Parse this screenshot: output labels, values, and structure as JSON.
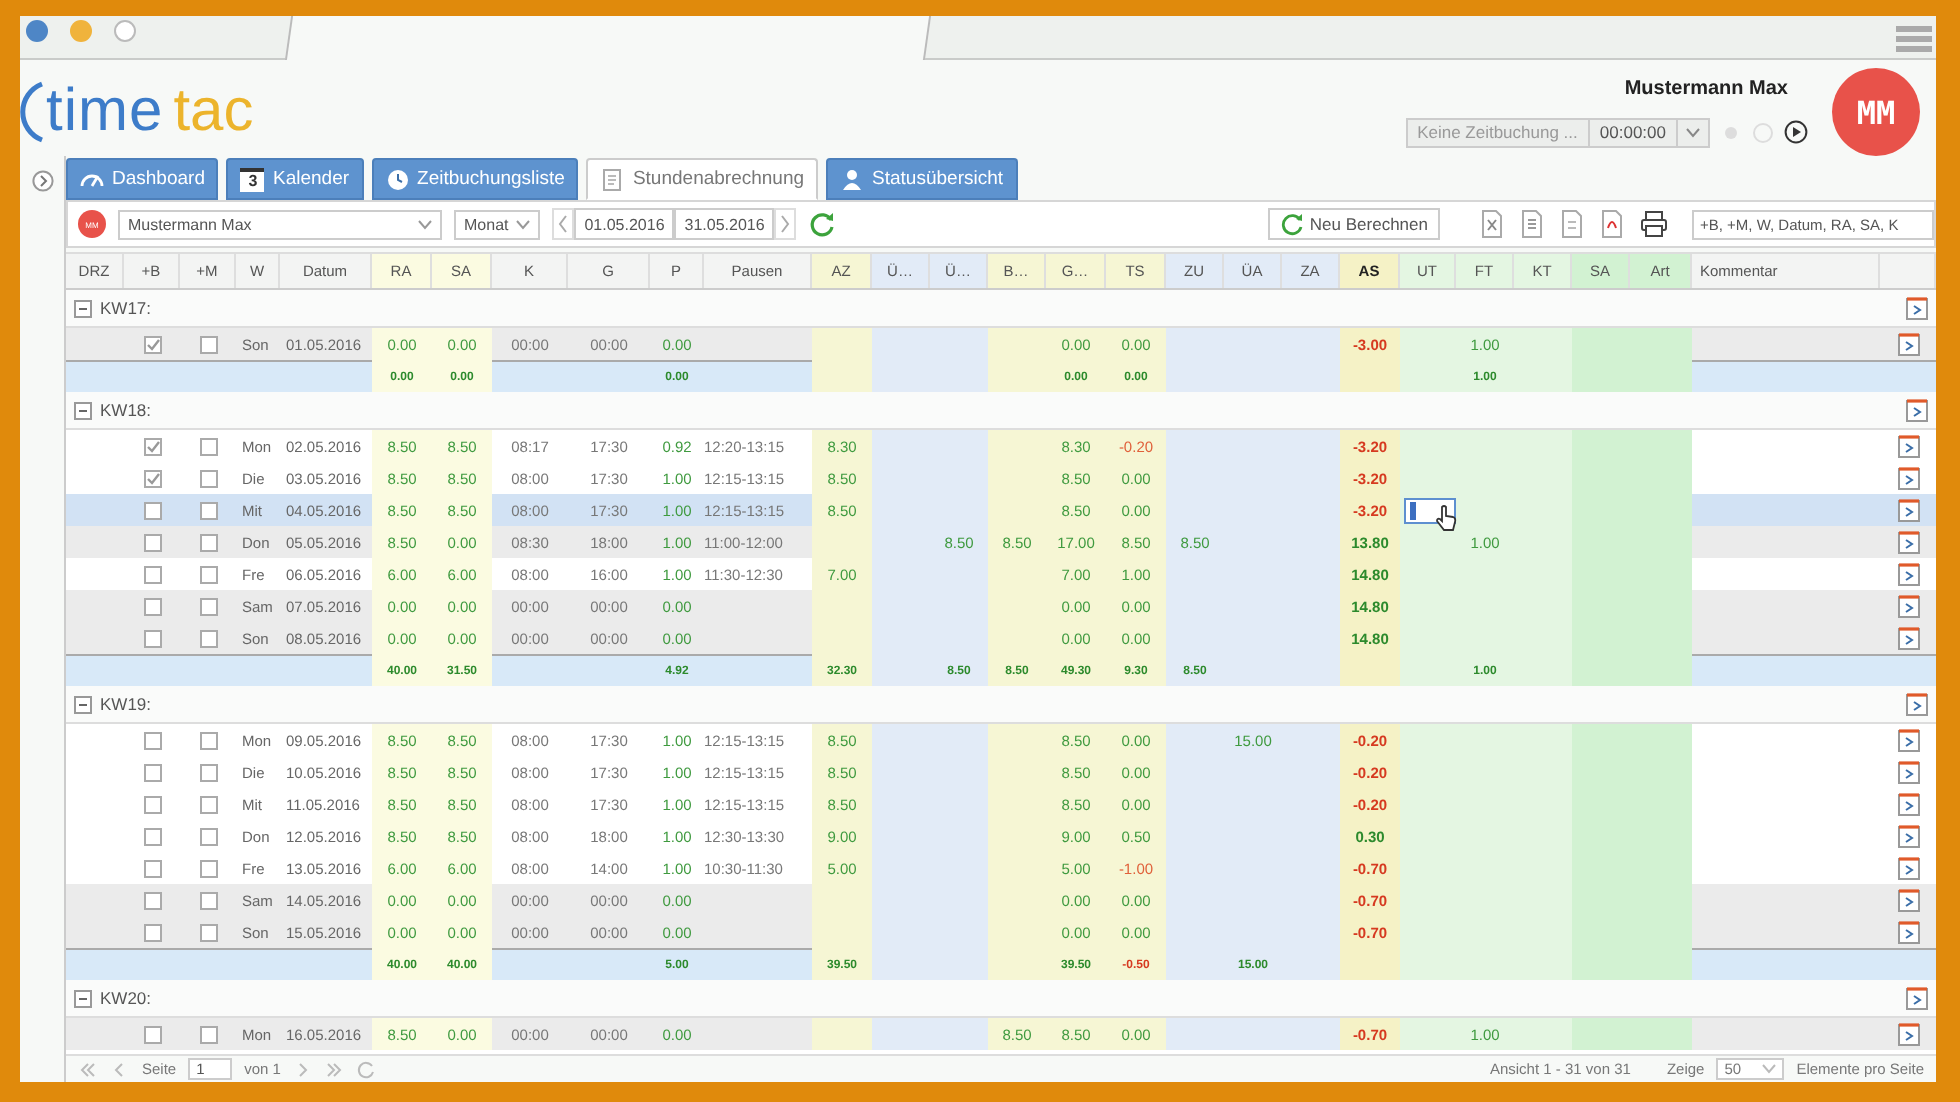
{
  "header": {
    "logo": {
      "first": "time",
      "second": "tac"
    },
    "user": {
      "name": "Mustermann Max",
      "initials": "MM"
    },
    "tracker": {
      "status": "Keine Zeitbuchung ...",
      "time": "00:00:00"
    }
  },
  "tabs": [
    {
      "label": "Dashboard",
      "kind": "dashboard",
      "selected": false
    },
    {
      "label": "Kalender",
      "kind": "calendar",
      "badge": "3",
      "selected": false
    },
    {
      "label": "Zeitbuchungsliste",
      "kind": "clock",
      "selected": false
    },
    {
      "label": "Stundenabrechnung",
      "kind": "document",
      "selected": true
    },
    {
      "label": "Statusübersicht",
      "kind": "person",
      "selected": false
    }
  ],
  "toolbar": {
    "person_initials": "MM",
    "person": "Mustermann Max",
    "period": "Monat",
    "from": "01.05.2016",
    "to": "31.05.2016",
    "recalc": "Neu Berechnen",
    "columns": "+B, +M, W, Datum, RA, SA, K"
  },
  "table": {
    "columns": [
      {
        "label": "DRZ",
        "kind": "plain"
      },
      {
        "label": "+B",
        "kind": "plain"
      },
      {
        "label": "+M",
        "kind": "plain"
      },
      {
        "label": "W",
        "kind": "plain"
      },
      {
        "label": "Datum",
        "kind": "plain"
      },
      {
        "label": "RA",
        "kind": "target"
      },
      {
        "label": "SA",
        "kind": "target"
      },
      {
        "label": "K",
        "kind": "plain"
      },
      {
        "label": "G",
        "kind": "plain"
      },
      {
        "label": "P",
        "kind": "plain"
      },
      {
        "label": "Pausen",
        "kind": "plain"
      },
      {
        "label": "AZ",
        "kind": "actual"
      },
      {
        "label": "Ü…",
        "kind": "overtime"
      },
      {
        "label": "Ü…",
        "kind": "overtime"
      },
      {
        "label": "B…",
        "kind": "actual"
      },
      {
        "label": "G…",
        "kind": "actual"
      },
      {
        "label": "TS",
        "kind": "difference"
      },
      {
        "label": "ZU",
        "kind": "overtime"
      },
      {
        "label": "ÜA",
        "kind": "overtime"
      },
      {
        "label": "ZA",
        "kind": "overtime"
      },
      {
        "label": "AS",
        "kind": "balance"
      },
      {
        "label": "UT",
        "kind": "absence"
      },
      {
        "label": "FT",
        "kind": "absence"
      },
      {
        "label": "KT",
        "kind": "absence"
      },
      {
        "label": "SA",
        "kind": "leave"
      },
      {
        "label": "Art",
        "kind": "leave"
      },
      {
        "label": "Kommentar",
        "kind": "plain"
      }
    ],
    "groups": [
      {
        "label": "KW17:",
        "expanded": true,
        "rows": [
          {
            "day": "Son",
            "date": "01.05.2016",
            "checks": [
              true,
              false
            ],
            "selected": false,
            "shaded": true,
            "editing": false,
            "diff_negative": false,
            "balance_negative": true,
            "ra": "0.00",
            "sa": "0.00",
            "come": "00:00",
            "go": "00:00",
            "pause": "0.00",
            "g": "0.00",
            "ts": "0.00",
            "as": "-3.00",
            "ft": "1.00"
          }
        ],
        "totals": {
          "diff_negative": false,
          "ra": "0.00",
          "sa": "0.00",
          "pause": "0.00",
          "g": "0.00",
          "ts": "0.00",
          "ft": "1.00"
        }
      },
      {
        "label": "KW18:",
        "expanded": true,
        "rows": [
          {
            "day": "Mon",
            "date": "02.05.2016",
            "checks": [
              true,
              false
            ],
            "selected": false,
            "shaded": false,
            "editing": false,
            "diff_negative": true,
            "balance_negative": true,
            "ra": "8.50",
            "sa": "8.50",
            "come": "08:17",
            "go": "17:30",
            "pause": "0.92",
            "breaks": "12:20-13:15",
            "az": "8.30",
            "g": "8.30",
            "ts": "-0.20",
            "as": "-3.20"
          },
          {
            "day": "Die",
            "date": "03.05.2016",
            "checks": [
              true,
              false
            ],
            "selected": false,
            "shaded": false,
            "editing": false,
            "diff_negative": false,
            "balance_negative": true,
            "ra": "8.50",
            "sa": "8.50",
            "come": "08:00",
            "go": "17:30",
            "pause": "1.00",
            "breaks": "12:15-13:15",
            "az": "8.50",
            "g": "8.50",
            "ts": "0.00",
            "as": "-3.20"
          },
          {
            "day": "Mit",
            "date": "04.05.2016",
            "checks": [
              false,
              false
            ],
            "selected": true,
            "shaded": false,
            "editing": true,
            "diff_negative": false,
            "balance_negative": true,
            "ra": "8.50",
            "sa": "8.50",
            "come": "08:00",
            "go": "17:30",
            "pause": "1.00",
            "breaks": "12:15-13:15",
            "az": "8.50",
            "g": "8.50",
            "ts": "0.00",
            "as": "-3.20"
          },
          {
            "day": "Don",
            "date": "05.05.2016",
            "checks": [
              false,
              false
            ],
            "selected": false,
            "shaded": true,
            "editing": false,
            "diff_negative": false,
            "balance_negative": false,
            "ra": "8.50",
            "sa": "0.00",
            "come": "08:30",
            "go": "18:00",
            "pause": "1.00",
            "breaks": "11:00-12:00",
            "ue2": "8.50",
            "b": "8.50",
            "g": "17.00",
            "ts": "8.50",
            "zu": "8.50",
            "as": "13.80",
            "ft": "1.00"
          },
          {
            "day": "Fre",
            "date": "06.05.2016",
            "checks": [
              false,
              false
            ],
            "selected": false,
            "shaded": false,
            "editing": false,
            "diff_negative": false,
            "balance_negative": false,
            "ra": "6.00",
            "sa": "6.00",
            "come": "08:00",
            "go": "16:00",
            "pause": "1.00",
            "breaks": "11:30-12:30",
            "az": "7.00",
            "g": "7.00",
            "ts": "1.00",
            "as": "14.80"
          },
          {
            "day": "Sam",
            "date": "07.05.2016",
            "checks": [
              false,
              false
            ],
            "selected": false,
            "shaded": true,
            "editing": false,
            "diff_negative": false,
            "balance_negative": false,
            "ra": "0.00",
            "sa": "0.00",
            "come": "00:00",
            "go": "00:00",
            "pause": "0.00",
            "g": "0.00",
            "ts": "0.00",
            "as": "14.80"
          },
          {
            "day": "Son",
            "date": "08.05.2016",
            "checks": [
              false,
              false
            ],
            "selected": false,
            "shaded": true,
            "editing": false,
            "diff_negative": false,
            "balance_negative": false,
            "ra": "0.00",
            "sa": "0.00",
            "come": "00:00",
            "go": "00:00",
            "pause": "0.00",
            "g": "0.00",
            "ts": "0.00",
            "as": "14.80"
          }
        ],
        "totals": {
          "diff_negative": false,
          "ra": "40.00",
          "sa": "31.50",
          "pause": "4.92",
          "az": "32.30",
          "ue2": "8.50",
          "b": "8.50",
          "g": "49.30",
          "ts": "9.30",
          "zu": "8.50",
          "ft": "1.00"
        }
      },
      {
        "label": "KW19:",
        "expanded": true,
        "rows": [
          {
            "day": "Mon",
            "date": "09.05.2016",
            "checks": [
              false,
              false
            ],
            "selected": false,
            "shaded": false,
            "editing": false,
            "diff_negative": false,
            "balance_negative": true,
            "ra": "8.50",
            "sa": "8.50",
            "come": "08:00",
            "go": "17:30",
            "pause": "1.00",
            "breaks": "12:15-13:15",
            "az": "8.50",
            "g": "8.50",
            "ts": "0.00",
            "ua": "15.00",
            "as": "-0.20"
          },
          {
            "day": "Die",
            "date": "10.05.2016",
            "checks": [
              false,
              false
            ],
            "selected": false,
            "shaded": false,
            "editing": false,
            "diff_negative": false,
            "balance_negative": true,
            "ra": "8.50",
            "sa": "8.50",
            "come": "08:00",
            "go": "17:30",
            "pause": "1.00",
            "breaks": "12:15-13:15",
            "az": "8.50",
            "g": "8.50",
            "ts": "0.00",
            "as": "-0.20"
          },
          {
            "day": "Mit",
            "date": "11.05.2016",
            "checks": [
              false,
              false
            ],
            "selected": false,
            "shaded": false,
            "editing": false,
            "diff_negative": false,
            "balance_negative": true,
            "ra": "8.50",
            "sa": "8.50",
            "come": "08:00",
            "go": "17:30",
            "pause": "1.00",
            "breaks": "12:15-13:15",
            "az": "8.50",
            "g": "8.50",
            "ts": "0.00",
            "as": "-0.20"
          },
          {
            "day": "Don",
            "date": "12.05.2016",
            "checks": [
              false,
              false
            ],
            "selected": false,
            "shaded": false,
            "editing": false,
            "diff_negative": false,
            "balance_negative": false,
            "ra": "8.50",
            "sa": "8.50",
            "come": "08:00",
            "go": "18:00",
            "pause": "1.00",
            "breaks": "12:30-13:30",
            "az": "9.00",
            "g": "9.00",
            "ts": "0.50",
            "as": "0.30"
          },
          {
            "day": "Fre",
            "date": "13.05.2016",
            "checks": [
              false,
              false
            ],
            "selected": false,
            "shaded": false,
            "editing": false,
            "diff_negative": true,
            "balance_negative": true,
            "ra": "6.00",
            "sa": "6.00",
            "come": "08:00",
            "go": "14:00",
            "pause": "1.00",
            "breaks": "10:30-11:30",
            "az": "5.00",
            "g": "5.00",
            "ts": "-1.00",
            "as": "-0.70"
          },
          {
            "day": "Sam",
            "date": "14.05.2016",
            "checks": [
              false,
              false
            ],
            "selected": false,
            "shaded": true,
            "editing": false,
            "diff_negative": false,
            "balance_negative": true,
            "ra": "0.00",
            "sa": "0.00",
            "come": "00:00",
            "go": "00:00",
            "pause": "0.00",
            "g": "0.00",
            "ts": "0.00",
            "as": "-0.70"
          },
          {
            "day": "Son",
            "date": "15.05.2016",
            "checks": [
              false,
              false
            ],
            "selected": false,
            "shaded": true,
            "editing": false,
            "diff_negative": false,
            "balance_negative": true,
            "ra": "0.00",
            "sa": "0.00",
            "come": "00:00",
            "go": "00:00",
            "pause": "0.00",
            "g": "0.00",
            "ts": "0.00",
            "as": "-0.70"
          }
        ],
        "totals": {
          "diff_negative": true,
          "ra": "40.00",
          "sa": "40.00",
          "pause": "5.00",
          "az": "39.50",
          "g": "39.50",
          "ts": "-0.50",
          "ua": "15.00"
        }
      },
      {
        "label": "KW20:",
        "expanded": true,
        "rows": [
          {
            "day": "Mon",
            "date": "16.05.2016",
            "checks": [
              false,
              false
            ],
            "selected": false,
            "shaded": true,
            "editing": false,
            "diff_negative": false,
            "balance_negative": true,
            "ra": "8.50",
            "sa": "0.00",
            "come": "00:00",
            "go": "00:00",
            "pause": "0.00",
            "b": "8.50",
            "g": "8.50",
            "ts": "0.00",
            "as": "-0.70",
            "ft": "1.00"
          }
        ]
      }
    ]
  },
  "pager": {
    "page_label": "Seite",
    "page": "1",
    "of": "von 1",
    "summary": "Ansicht 1 - 31 von 31",
    "show_label": "Zeige",
    "page_size": "50",
    "per_page_label": "Elemente pro Seite"
  }
}
